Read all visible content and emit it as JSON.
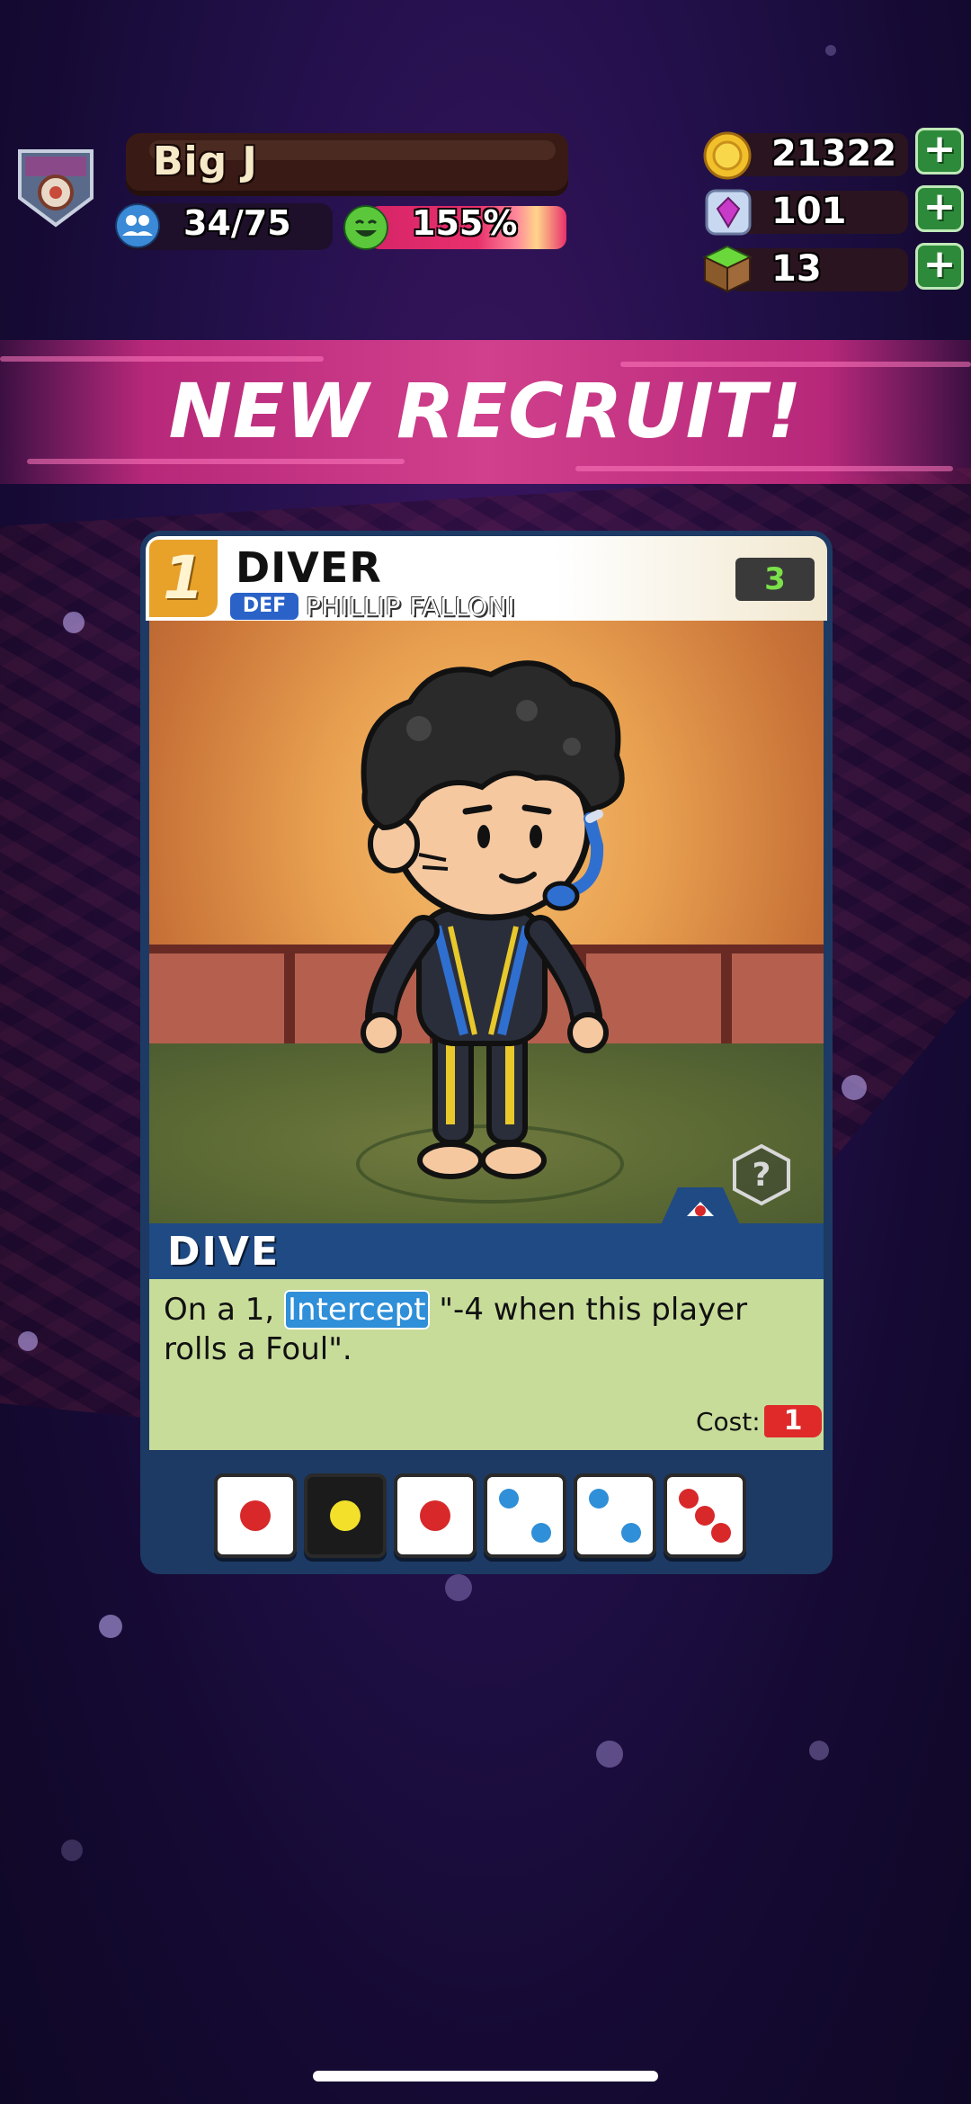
{
  "player": {
    "name": "Big J",
    "roster": "34/75",
    "morale": "155%"
  },
  "currencies": [
    {
      "name": "coins",
      "value": "21322",
      "icon": "coin-icon",
      "add": "+"
    },
    {
      "name": "gems",
      "value": "101",
      "icon": "gem-icon",
      "add": "+"
    },
    {
      "name": "turf",
      "value": "13",
      "icon": "turf-block-icon",
      "add": "+"
    }
  ],
  "banner": {
    "title": "NEW RECRUIT!"
  },
  "card": {
    "level": "1",
    "name": "DIVER",
    "position": "DEF",
    "player_name": "PHILLIP FALLONI",
    "rating": "3",
    "ability": {
      "title": "DIVE",
      "text_prefix": "On a 1, ",
      "keyword": "Intercept",
      "text_suffix": " \"-4 when this player rolls a Foul\".",
      "cost_label": "Cost:",
      "cost": "1"
    },
    "dice": [
      {
        "face": 1,
        "style": "light",
        "pip_color": "#d8282a"
      },
      {
        "face": 1,
        "style": "dark",
        "pip_color": "#f2e02a"
      },
      {
        "face": 1,
        "style": "light",
        "pip_color": "#d8282a"
      },
      {
        "face": 2,
        "style": "light",
        "pip_color": "#2f8fd8"
      },
      {
        "face": 2,
        "style": "light",
        "pip_color": "#2f8fd8"
      },
      {
        "face": 3,
        "style": "light",
        "pip_color": "#d8282a"
      }
    ]
  },
  "colors": {
    "accent_pink": "#d0408c",
    "card_navy": "#1d3a64",
    "ability_green": "#c8dc9a",
    "add_green": "#2e8a3b"
  }
}
